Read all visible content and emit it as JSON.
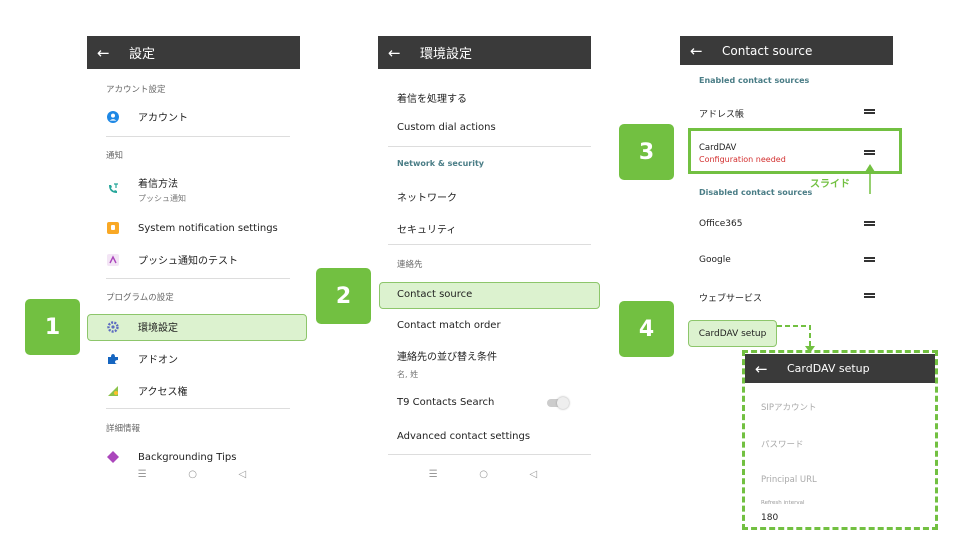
{
  "colors": {
    "accent_green": "#72c041",
    "highlight_bg": "#dcf2cf",
    "appbar": "#3a3a3a",
    "error_red": "#d32f2f"
  },
  "badges": [
    "1",
    "2",
    "3",
    "4"
  ],
  "annotation": {
    "slide_label": "スライド"
  },
  "screen1": {
    "title": "設定",
    "back": "←",
    "sections": {
      "account": "アカウント設定",
      "notify": "通知",
      "program": "プログラムの設定",
      "details": "詳細情報"
    },
    "items": {
      "account": "アカウント",
      "incoming": "着信方法",
      "incoming_sub": "プッシュ通知",
      "system_notif": "System notification settings",
      "push_test": "プッシュ通知のテスト",
      "env": "環境設定",
      "addon": "アドオン",
      "access": "アクセス権",
      "bg_tips": "Backgrounding Tips"
    },
    "nav": {
      "menu": "☰",
      "home": "○",
      "back": "◁"
    }
  },
  "screen2": {
    "title": "環境設定",
    "back": "←",
    "items": {
      "handle_call": "着信を処理する",
      "dial_actions": "Custom dial actions",
      "network": "ネットワーク",
      "security": "セキュリティ",
      "contact_source": "Contact source",
      "match_order": "Contact match order",
      "sort": "連絡先の並び替え条件",
      "sort_sub": "名, 姓",
      "t9": "T9 Contacts Search",
      "advanced": "Advanced contact settings"
    },
    "sections": {
      "network_security": "Network & security",
      "contacts": "連絡先"
    },
    "nav": {
      "menu": "☰",
      "home": "○",
      "back": "◁"
    }
  },
  "screen3": {
    "title": "Contact source",
    "back": "←",
    "enabled_header": "Enabled contact sources",
    "disabled_header": "Disabled contact sources",
    "enabled": [
      {
        "name": "アドレス帳"
      },
      {
        "name": "CardDAV",
        "status": "Configuration needed"
      }
    ],
    "disabled": [
      {
        "name": "Office365"
      },
      {
        "name": "Google"
      },
      {
        "name": "ウェブサービス"
      }
    ],
    "setup_button": "CardDAV setup"
  },
  "screen4": {
    "title": "CardDAV setup",
    "back": "←",
    "fields": {
      "sip_account": "SIPアカウント",
      "password": "パスワード",
      "principal_url": "Principal URL",
      "refresh_label": "Refresh interval",
      "refresh_value": "180"
    }
  }
}
